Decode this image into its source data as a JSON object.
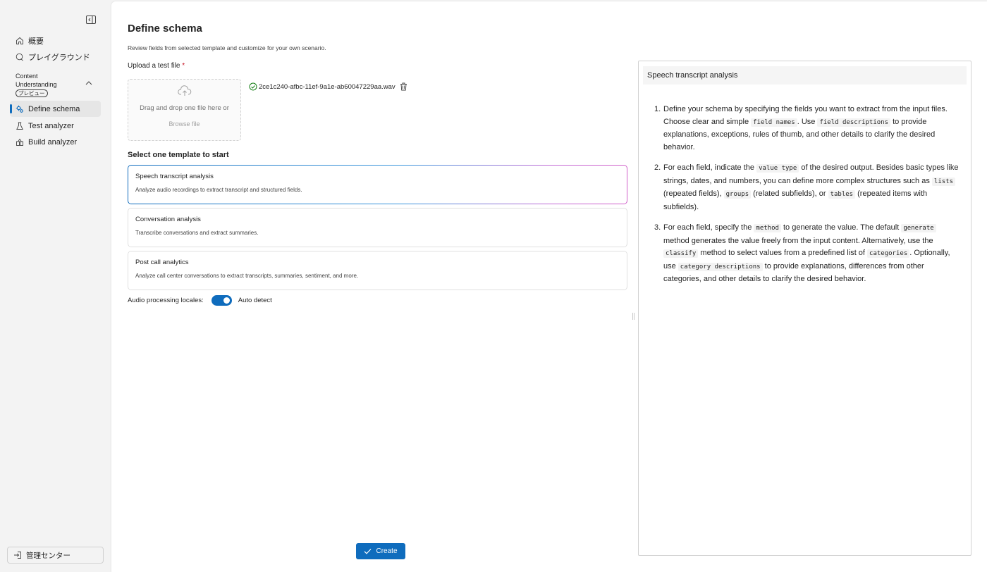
{
  "sidebar": {
    "items": [
      {
        "label": "概要",
        "icon": "home-icon"
      },
      {
        "label": "プレイグラウンド",
        "icon": "playground-icon"
      }
    ],
    "section": {
      "label": "Content Understanding",
      "badge": "プレビュー"
    },
    "sub_items": [
      {
        "label": "Define schema",
        "icon": "gear-icon",
        "active": true
      },
      {
        "label": "Test analyzer",
        "icon": "flask-icon",
        "active": false
      },
      {
        "label": "Build analyzer",
        "icon": "build-icon",
        "active": false
      }
    ],
    "admin_label": "管理センター"
  },
  "main": {
    "title": "Define schema",
    "description": "Review fields from selected template and customize for your own scenario.",
    "upload": {
      "label": "Upload a test file",
      "required_marker": "*",
      "drop_text": "Drag and drop one file here or",
      "browse_text": "Browse file",
      "file_name": "2ce1c240-afbc-11ef-9a1e-ab60047229aa.wav"
    },
    "templates_heading": "Select one template to start",
    "templates": [
      {
        "title": "Speech transcript analysis",
        "description": "Analyze audio recordings to extract transcript and structured fields.",
        "selected": true
      },
      {
        "title": "Conversation analysis",
        "description": "Transcribe conversations and extract summaries.",
        "selected": false
      },
      {
        "title": "Post call analytics",
        "description": "Analyze call center conversations to extract transcripts, summaries, sentiment, and more.",
        "selected": false
      }
    ],
    "locales": {
      "label": "Audio processing locales:",
      "toggle_on": true,
      "value_label": "Auto detect"
    },
    "create_label": "Create"
  },
  "guide": {
    "title": "Speech transcript analysis",
    "steps": [
      {
        "num": "1.",
        "parts": [
          {
            "t": "Define your schema by specifying the fields you want to extract from the input files. Choose clear and simple "
          },
          {
            "c": "field names"
          },
          {
            "t": ". Use "
          },
          {
            "c": "field descriptions"
          },
          {
            "t": " to provide explanations, exceptions, rules of thumb, and other details to clarify the desired behavior."
          }
        ]
      },
      {
        "num": "2.",
        "parts": [
          {
            "t": "For each field, indicate the "
          },
          {
            "c": "value type"
          },
          {
            "t": " of the desired output. Besides basic types like strings, dates, and numbers, you can define more complex structures such as "
          },
          {
            "c": "lists"
          },
          {
            "t": " (repeated fields), "
          },
          {
            "c": "groups"
          },
          {
            "t": " (related subfields), or "
          },
          {
            "c": "tables"
          },
          {
            "t": " (repeated items with subfields)."
          }
        ]
      },
      {
        "num": "3.",
        "parts": [
          {
            "t": "For each field, specify the "
          },
          {
            "c": "method"
          },
          {
            "t": " to generate the value. The default "
          },
          {
            "c": "generate"
          },
          {
            "t": " method generates the value freely from the input content. Alternatively, use the "
          },
          {
            "c": "classify"
          },
          {
            "t": " method to select values from a predefined list of "
          },
          {
            "c": "categories"
          },
          {
            "t": ". Optionally, use "
          },
          {
            "c": "category descriptions"
          },
          {
            "t": " to provide explanations, differences from other categories, and other details to clarify the desired behavior."
          }
        ]
      }
    ]
  },
  "colors": {
    "accent": "#0f6cbd",
    "success": "#107c10",
    "required": "#c50f1f"
  }
}
